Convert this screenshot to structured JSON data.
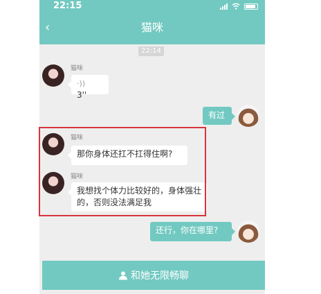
{
  "status_bar": {
    "time": "22:15"
  },
  "navbar": {
    "back_icon": "chevron-left-icon",
    "title": "猫咪"
  },
  "timestamp": "22:14",
  "messages": [
    {
      "sender": "猫咪",
      "type": "voice",
      "duration": "3''"
    },
    {
      "sender": "me",
      "text": "有过"
    },
    {
      "sender": "猫咪",
      "text": "那你身体还扛不扛得住啊?"
    },
    {
      "sender": "猫咪",
      "text": "我想找个体力比较好的，身体强壮的，否则没法满足我"
    },
    {
      "sender": "me",
      "text": "还行，你在哪里?"
    }
  ],
  "chat_button": {
    "icon": "user-icon",
    "label": "和她无限畅聊"
  },
  "colors": {
    "accent": "#72c9c1",
    "highlight": "#d9343b",
    "background": "#eeeeee"
  }
}
